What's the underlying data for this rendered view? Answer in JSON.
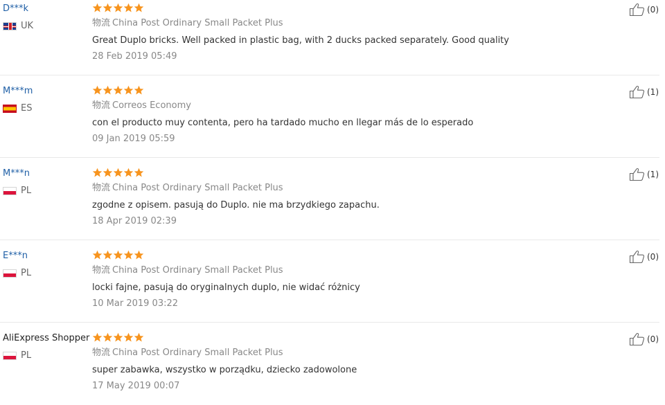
{
  "colors": {
    "star": "#f7941e",
    "buyer_link": "#1f5fa6",
    "muted": "#888888",
    "text": "#333333",
    "divider": "#e8e8e8"
  },
  "icons": {
    "star": "star-icon",
    "helpful": "thumbs-up-icon",
    "flag": "country-flag-icon"
  },
  "reviews": [
    {
      "buyer": "D***k",
      "country_code": "UK",
      "flag": "uk",
      "rating": 5,
      "logistics_label": "物流",
      "logistics": "China Post Ordinary Small Packet Plus",
      "text": "Great Duplo bricks. Well packed in plastic bag, with 2 ducks packed separately. Good quality",
      "date": "28 Feb 2019 05:49",
      "helpful_count": "(0)"
    },
    {
      "buyer": "M***m",
      "country_code": "ES",
      "flag": "es",
      "rating": 5,
      "logistics_label": "物流",
      "logistics": "Correos Economy",
      "text": "con el producto muy contenta, pero ha tardado mucho en llegar más de lo esperado",
      "date": "09 Jan 2019 05:59",
      "helpful_count": "(1)"
    },
    {
      "buyer": "M***n",
      "country_code": "PL",
      "flag": "pl",
      "rating": 5,
      "logistics_label": "物流",
      "logistics": "China Post Ordinary Small Packet Plus",
      "text": "zgodne z opisem. pasują do Duplo. nie ma brzydkiego zapachu.",
      "date": "18 Apr 2019 02:39",
      "helpful_count": "(1)"
    },
    {
      "buyer": "E***n",
      "country_code": "PL",
      "flag": "pl",
      "rating": 5,
      "logistics_label": "物流",
      "logistics": "China Post Ordinary Small Packet Plus",
      "text": "locki fajne, pasują do oryginalnych duplo, nie widać różnicy",
      "date": "10 Mar 2019 03:22",
      "helpful_count": "(0)"
    },
    {
      "buyer": "AliExpress Shopper",
      "country_code": "PL",
      "flag": "pl",
      "rating": 5,
      "logistics_label": "物流",
      "logistics": "China Post Ordinary Small Packet Plus",
      "text": "super zabawka, wszystko w porządku, dziecko zadowolone",
      "date": "17 May 2019 00:07",
      "helpful_count": "(0)"
    }
  ]
}
